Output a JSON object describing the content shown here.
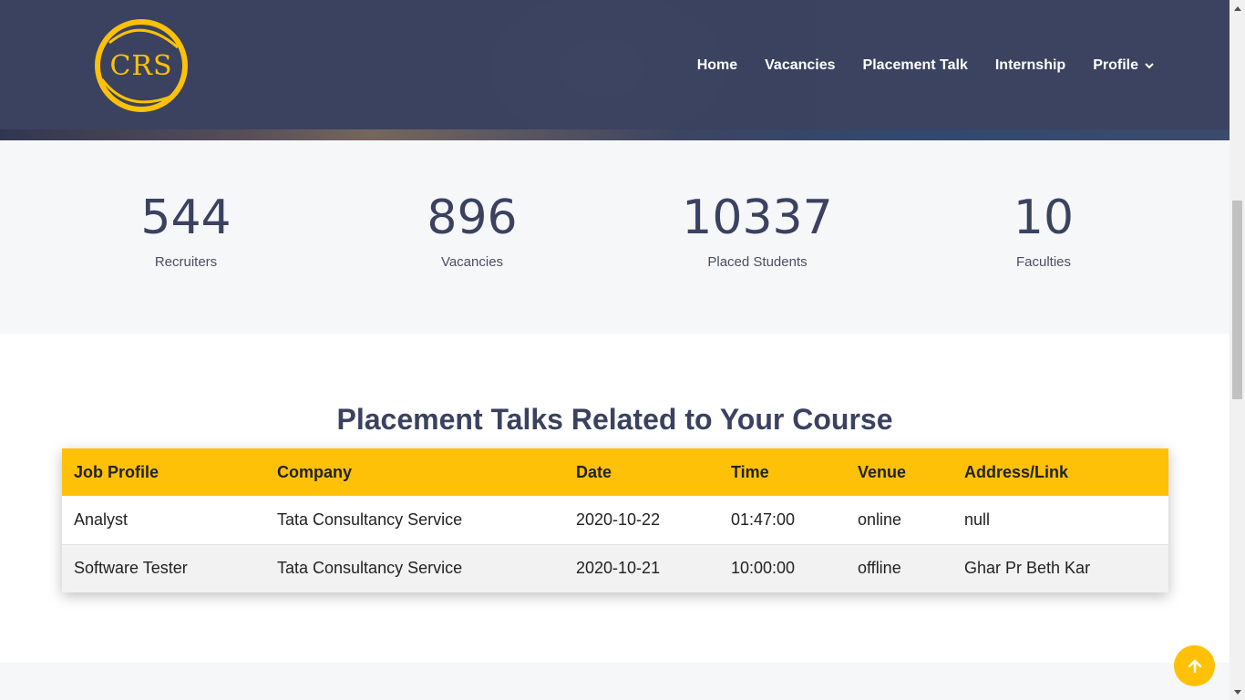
{
  "header": {
    "logo_text": "CRS",
    "nav": [
      {
        "label": "Home"
      },
      {
        "label": "Vacancies"
      },
      {
        "label": "Placement Talk"
      },
      {
        "label": "Internship"
      },
      {
        "label": "Profile"
      }
    ]
  },
  "stats": [
    {
      "value": "544",
      "label": "Recruiters"
    },
    {
      "value": "896",
      "label": "Vacancies"
    },
    {
      "value": "10337",
      "label": "Placed Students"
    },
    {
      "value": "10",
      "label": "Faculties"
    }
  ],
  "section": {
    "title": "Placement Talks Related to Your Course"
  },
  "table": {
    "headers": [
      "Job Profile",
      "Company",
      "Date",
      "Time",
      "Venue",
      "Address/Link"
    ],
    "rows": [
      [
        "Analyst",
        "Tata Consultancy Service",
        "2020-10-22",
        "01:47:00",
        "online",
        "null"
      ],
      [
        "Software Tester",
        "Tata Consultancy Service",
        "2020-10-21",
        "10:00:00",
        "offline",
        "Ghar Pr Beth Kar"
      ]
    ]
  },
  "colors": {
    "accent": "#ffc107",
    "header_bg": "#3b4260",
    "stats_bg": "#f6f7f9",
    "title_color": "#3b4260"
  },
  "icons": {
    "profile_dropdown": "chevron-down-icon",
    "scroll_top": "arrow-up-icon"
  }
}
